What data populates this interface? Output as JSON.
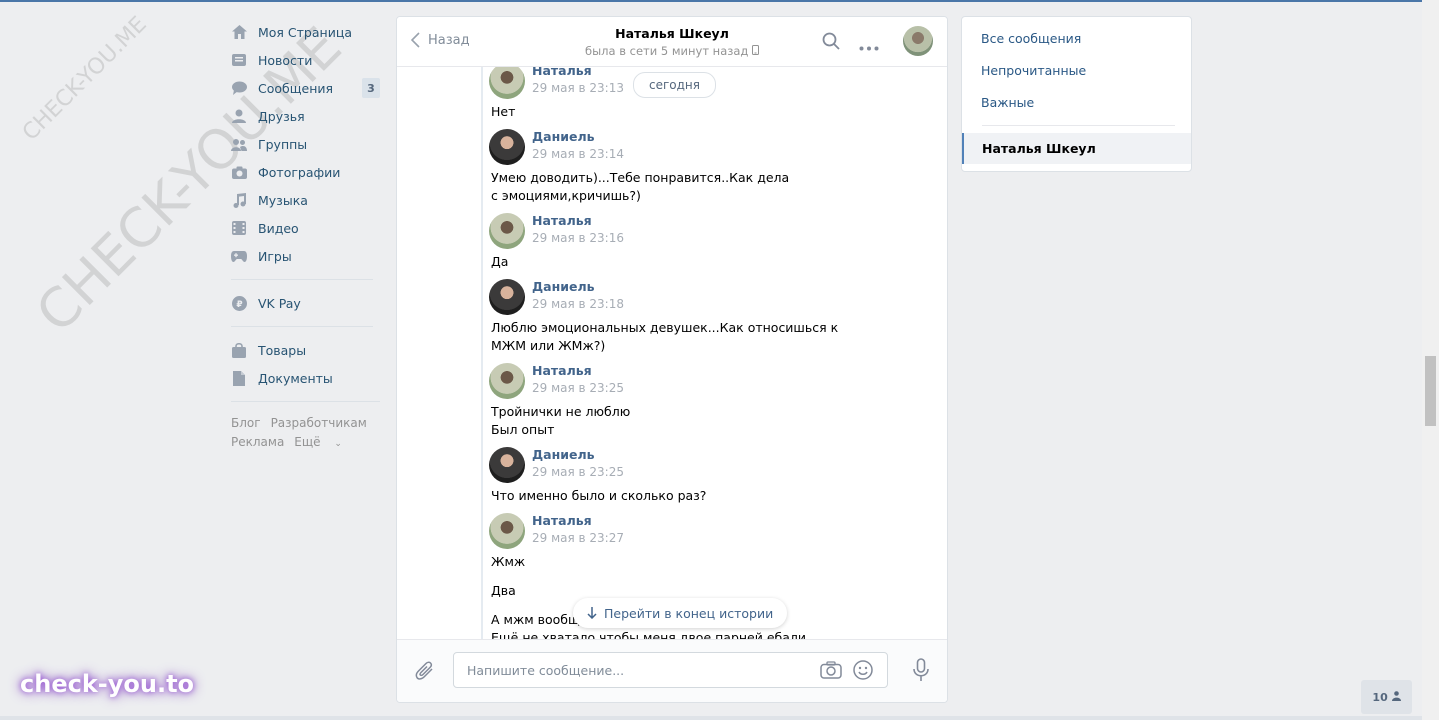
{
  "sidebar": {
    "items": [
      {
        "label": "Моя Страница",
        "icon": "home-icon"
      },
      {
        "label": "Новости",
        "icon": "news-icon"
      },
      {
        "label": "Сообщения",
        "icon": "messages-icon",
        "badge": "3"
      },
      {
        "label": "Друзья",
        "icon": "friends-icon"
      },
      {
        "label": "Группы",
        "icon": "groups-icon"
      },
      {
        "label": "Фотографии",
        "icon": "camera-icon"
      },
      {
        "label": "Музыка",
        "icon": "music-icon"
      },
      {
        "label": "Видео",
        "icon": "video-icon"
      },
      {
        "label": "Игры",
        "icon": "gamepad-icon"
      }
    ],
    "vkpay": "VK Pay",
    "extra": [
      "Товары",
      "Документы"
    ],
    "footer": {
      "blog": "Блог",
      "dev": "Разработчикам",
      "ads": "Реклама",
      "more": "Ещё"
    }
  },
  "chat": {
    "back_label": "Назад",
    "peer_name": "Наталья Шкеул",
    "peer_status": "была в сети 5 минут назад",
    "date_divider": "сегодня",
    "jump_label": "Перейти в конец истории",
    "input_placeholder": "Напишите сообщение...",
    "messages": [
      {
        "sender": "Наталья",
        "time": "29 мая в 23:13",
        "text": "Нет"
      },
      {
        "sender": "Даниель",
        "time": "29 мая в 23:14",
        "text": "Умею доводить)...Тебе понравится..Как дела с эмоциями,кричишь?)"
      },
      {
        "sender": "Наталья",
        "time": "29 мая в 23:16",
        "text": "Да"
      },
      {
        "sender": "Даниель",
        "time": "29 мая в 23:18",
        "text": "Люблю эмоциональных девушек...Как относишься к МЖМ или ЖМж?)"
      },
      {
        "sender": "Наталья",
        "time": "29 мая в 23:25",
        "text": "Тройнички не люблю",
        "text2": "Был опыт"
      },
      {
        "sender": "Даниель",
        "time": "29 мая в 23:25",
        "text": "Что именно было и сколько раз?"
      },
      {
        "sender": "Наталья",
        "time": "29 мая в 23:27",
        "text": "Жмж",
        "text2": "Два",
        "text3": "А мжм вообщ",
        "text4": "Ещё не хватало,чтобы меня двое парней ебали"
      }
    ]
  },
  "filters": {
    "all": "Все сообщения",
    "unread": "Непрочитанные",
    "important": "Важные",
    "active": "Наталья Шкеул"
  },
  "online_count": "10",
  "watermarks": {
    "wm1": "CHECK-YOU.ME",
    "wm2": "CHECK-YOU.ME",
    "brand": "check-you.to"
  },
  "colors": {
    "accent": "#4a76a8",
    "link": "#2a5885",
    "sender": "#42648b"
  }
}
